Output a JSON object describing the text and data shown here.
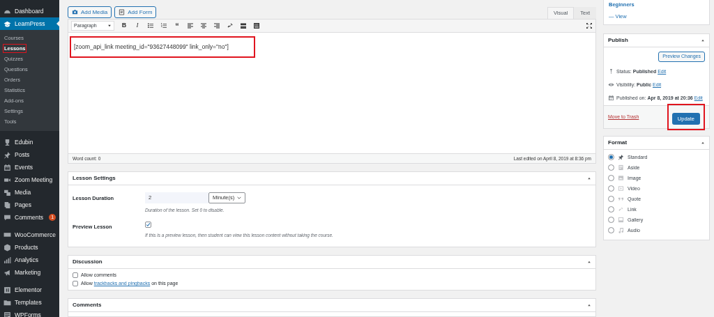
{
  "sidebar": {
    "groups": [
      {
        "items": [
          {
            "label": "Dashboard",
            "selected": false
          },
          {
            "label": "LearnPress",
            "selected": true,
            "expanded": true,
            "children": [
              {
                "label": "Courses",
                "selected": false,
                "highlighted": false
              },
              {
                "label": "Lessons",
                "selected": true,
                "highlighted": true
              },
              {
                "label": "Quizzes",
                "selected": false,
                "highlighted": false
              },
              {
                "label": "Questions",
                "selected": false,
                "highlighted": false
              },
              {
                "label": "Orders",
                "selected": false,
                "highlighted": false
              },
              {
                "label": "Statistics",
                "selected": false,
                "highlighted": false
              },
              {
                "label": "Add-ons",
                "selected": false,
                "highlighted": false
              },
              {
                "label": "Settings",
                "selected": false,
                "highlighted": false
              },
              {
                "label": "Tools",
                "selected": false,
                "highlighted": false
              }
            ]
          }
        ]
      },
      {
        "items": [
          {
            "label": "Edubin",
            "selected": false
          },
          {
            "label": "Posts",
            "selected": false
          },
          {
            "label": "Events",
            "selected": false
          },
          {
            "label": "Zoom Meeting",
            "selected": false
          },
          {
            "label": "Media",
            "selected": false
          },
          {
            "label": "Pages",
            "selected": false
          },
          {
            "label": "Comments",
            "selected": false,
            "badge": "1"
          }
        ]
      },
      {
        "items": [
          {
            "label": "WooCommerce",
            "selected": false
          },
          {
            "label": "Products",
            "selected": false
          },
          {
            "label": "Analytics",
            "selected": false
          },
          {
            "label": "Marketing",
            "selected": false
          }
        ]
      },
      {
        "items": [
          {
            "label": "Elementor",
            "selected": false
          },
          {
            "label": "Templates",
            "selected": false
          },
          {
            "label": "WPForms",
            "selected": false
          }
        ]
      }
    ]
  },
  "editor": {
    "media_buttons": [
      "Add Media",
      "Add Form"
    ],
    "tabs": [
      {
        "label": "Visual",
        "selected": true
      },
      {
        "label": "Text",
        "selected": false
      }
    ],
    "toolbar": {
      "format": "Paragraph",
      "bold": "B",
      "italic": "I",
      "quote": "“"
    },
    "content": "[zoom_api_link meeting_id=\"93627448099\" link_only=\"no\"]",
    "content_highlighted": true,
    "word_count": "Word count: 0",
    "last_edited": "Last edited on April 8, 2019 at 8:36 pm"
  },
  "lesson_settings": {
    "title": "Lesson Settings",
    "duration_label": "Lesson Duration",
    "duration_value": "2",
    "duration_unit": "Minute(s)",
    "duration_hint": "Duration of the lesson. Set 0 to disable.",
    "preview_label": "Preview Lesson",
    "preview_checked": true,
    "preview_hint": "If this is a preview lesson, then student can view this lesson content without taking the course."
  },
  "discussion": {
    "title": "Discussion",
    "options": [
      {
        "before": "Allow comments",
        "checked": false
      },
      {
        "before": "Allow",
        "link": "trackbacks and pingbacks",
        "after": "on this page",
        "checked": false
      }
    ]
  },
  "comments_box": {
    "title": "Comments"
  },
  "course_box": {
    "course": "Beginners",
    "view": "— View"
  },
  "publish": {
    "title": "Publish",
    "preview_button": "Preview Changes",
    "rows": [
      {
        "label": "Status:",
        "value": "Published",
        "edit": "Edit"
      },
      {
        "label": "Visibility:",
        "value": "Public",
        "edit": "Edit"
      },
      {
        "label": "Published on:",
        "value": "Apr 8, 2019 at 20:36",
        "edit": "Edit"
      }
    ],
    "trash": "Move to Trash",
    "update": "Update",
    "update_highlighted": true
  },
  "format": {
    "title": "Format",
    "options": [
      {
        "label": "Standard",
        "selected": true
      },
      {
        "label": "Aside",
        "selected": false
      },
      {
        "label": "Image",
        "selected": false
      },
      {
        "label": "Video",
        "selected": false
      },
      {
        "label": "Quote",
        "selected": false
      },
      {
        "label": "Link",
        "selected": false
      },
      {
        "label": "Gallery",
        "selected": false
      },
      {
        "label": "Audio",
        "selected": false
      }
    ]
  }
}
